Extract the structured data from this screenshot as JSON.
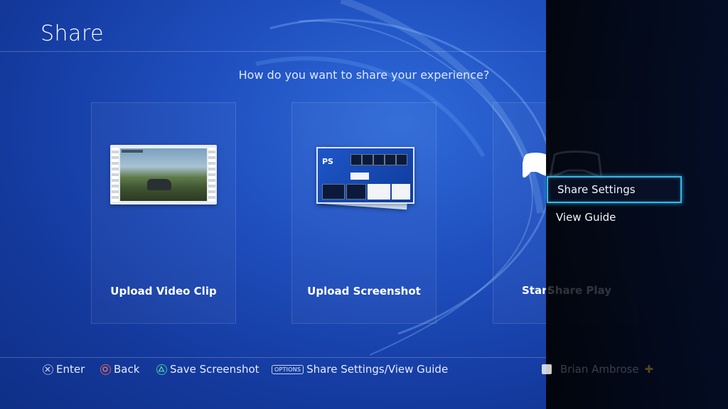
{
  "header": {
    "title": "Share"
  },
  "prompt": "How do you want to share your experience?",
  "cards": [
    {
      "label": "Upload Video Clip"
    },
    {
      "label": "Upload Screenshot"
    },
    {
      "label_visible": "Start",
      "label_dim": "Share Play"
    }
  ],
  "menu": {
    "items": [
      {
        "label": "Share Settings",
        "selected": true
      },
      {
        "label": "View Guide",
        "selected": false
      }
    ]
  },
  "hints": {
    "enter": "Enter",
    "back": "Back",
    "save_screenshot": "Save Screenshot",
    "options_badge": "OPTIONS",
    "options": "Share Settings/View Guide"
  },
  "user": {
    "name": "Brian Ambrose"
  },
  "colors": {
    "background": "#1f4fbf",
    "selection_border": "#38b6e8",
    "panel": "#000000",
    "cross": "#8fa6d8",
    "circle": "#e8604a",
    "triangle": "#3fc8a0"
  }
}
